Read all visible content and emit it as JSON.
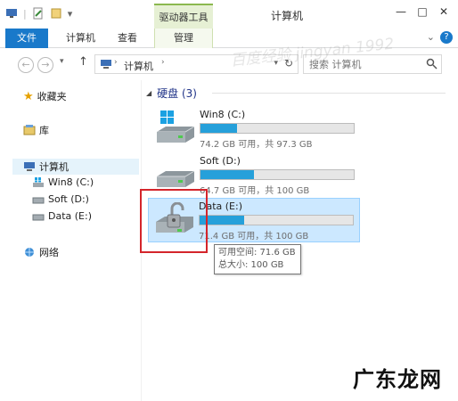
{
  "window": {
    "title": "计算机",
    "context_tab": "驱动器工具",
    "minimize": "—",
    "maximize": "□",
    "close": "✕"
  },
  "ribbon": {
    "tabs": [
      "文件",
      "计算机",
      "查看",
      "管理"
    ],
    "help": "?",
    "expand": "⌄"
  },
  "address": {
    "crumb": "计算机",
    "separator": "›",
    "refresh": "↻"
  },
  "search": {
    "placeholder": "搜索 计算机"
  },
  "nav_pane": {
    "favorites": "收藏夹",
    "libraries": "库",
    "computer": "计算机",
    "drives": [
      "Win8 (C:)",
      "Soft (D:)",
      "Data (E:)"
    ],
    "network": "网络"
  },
  "content": {
    "group_header": "硬盘 (3)",
    "drives": [
      {
        "name": "Win8 (C:)",
        "info": "74.2 GB 可用，共 97.3 GB",
        "used_fraction": 0.24
      },
      {
        "name": "Soft (D:)",
        "info": "64.7 GB 可用，共 100 GB",
        "used_fraction": 0.35
      },
      {
        "name": "Data (E:)",
        "info": "71.4 GB 可用，共 100 GB",
        "used_fraction": 0.29
      }
    ],
    "tooltip": {
      "free": "可用空间: 71.6 GB",
      "total": "总大小: 100 GB"
    }
  },
  "overlay": {
    "watermark": "百度经验 jingyan 1992",
    "site_logo": "广东龙网"
  },
  "colors": {
    "accent": "#1979ca",
    "bar_fill": "#26a0da",
    "selection": "#cce8ff",
    "highlight_box": "#d4252b"
  }
}
